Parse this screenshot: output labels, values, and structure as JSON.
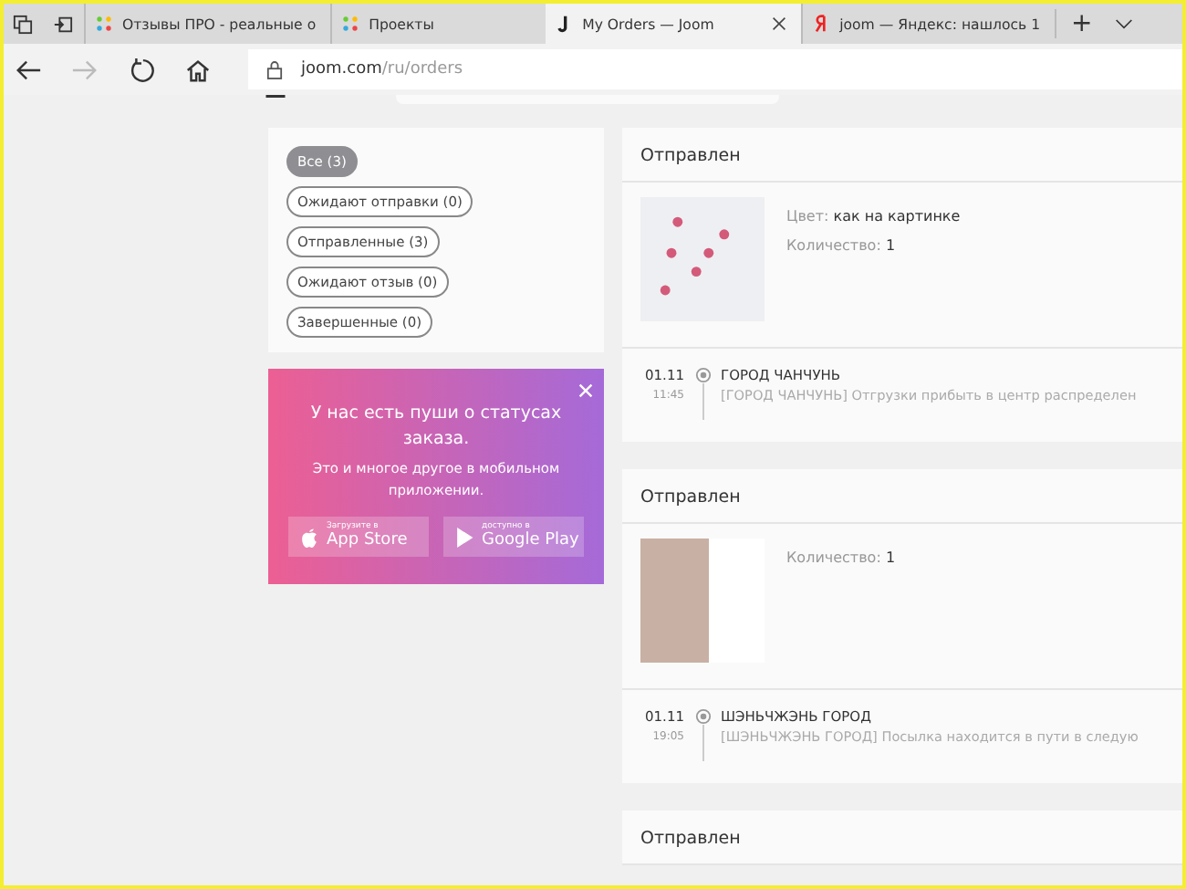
{
  "browser": {
    "tabs": [
      {
        "title": "Отзывы ПРО - реальные о",
        "selected": false
      },
      {
        "title": "Проекты",
        "selected": false
      },
      {
        "title": "My Orders — Joom",
        "selected": true
      },
      {
        "title": "joom — Яндекс: нашлось 1",
        "selected": false
      }
    ],
    "new_tab": "+",
    "address": {
      "domain": "joom.com",
      "path": "/ru/orders"
    }
  },
  "filters": [
    {
      "label": "Все (3)",
      "selected": true
    },
    {
      "label": "Ожидают отправки (0)",
      "selected": false
    },
    {
      "label": "Отправленные (3)",
      "selected": false
    },
    {
      "label": "Ожидают отзыв (0)",
      "selected": false
    },
    {
      "label": "Завершенные (0)",
      "selected": false
    }
  ],
  "promo": {
    "title": "У нас есть пуши о статусах заказа.",
    "subtitle": "Это и многое другое в мобильном приложении.",
    "stores": [
      {
        "kind": "apple",
        "small": "Загрузите в",
        "big": "App Store"
      },
      {
        "kind": "google",
        "small": "доступно в",
        "big": "Google Play"
      }
    ]
  },
  "orders": [
    {
      "status": "Отправлен",
      "variant": {
        "label": "Цвет:",
        "value": "как на картинке"
      },
      "quantity": {
        "label": "Количество:",
        "value": "1"
      },
      "tracking": {
        "date": "01.11",
        "time": "11:45",
        "city": "ГОРОД ЧАНЧУНЬ",
        "text": "[ГОРОД ЧАНЧУНЬ] Отгрузки прибыть в центр распределен"
      }
    },
    {
      "status": "Отправлен",
      "quantity": {
        "label": "Количество:",
        "value": "1"
      },
      "tracking": {
        "date": "01.11",
        "time": "19:05",
        "city": "ШЭНЬЧЖЭНЬ ГОРОД",
        "text": "[ШЭНЬЧЖЭНЬ ГОРОД] Посылка находится в пути в следую"
      }
    },
    {
      "status": "Отправлен"
    }
  ]
}
